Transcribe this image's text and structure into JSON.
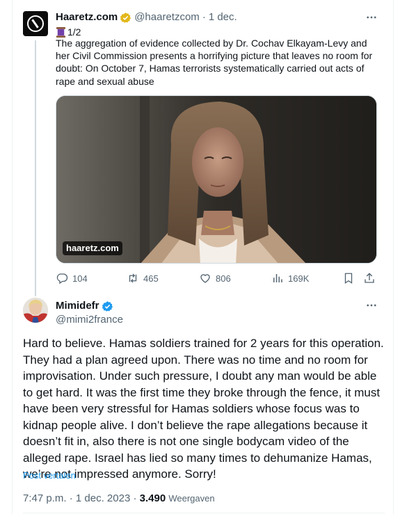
{
  "parent_tweet": {
    "author_name": "Haaretz.com",
    "author_handle": "@haaretzcom",
    "separator": "·",
    "date": "1 dec.",
    "thread_emoji": "spool-of-thread",
    "thread_index": "1/2",
    "text": "The aggregation of evidence collected by Dr. Cochav Elkayam-Levy and her Civil Commission presents a horrifying picture that leaves no room for doubt: On October 7, Hamas terrorists systematically carried out acts of rape and sexual abuse",
    "media_source_label": "haaretz.com",
    "stats": {
      "replies": "104",
      "reposts": "465",
      "likes": "806",
      "views": "169K"
    },
    "icons": [
      "reply-icon",
      "repost-icon",
      "like-icon",
      "views-icon",
      "bookmark-icon",
      "share-icon"
    ]
  },
  "reply_tweet": {
    "author_name": "Mimidefr",
    "author_handle": "@mimi2france",
    "text": "Hard to believe. Hamas soldiers trained for 2 years for this operation. They had a plan agreed upon. There was no time and no room for improvisation. Under such pressure, I doubt any man would be able to get hard. It was the first time they broke through the fence, it must have been very stressful for Hamas soldiers whose focus was to kidnap people alive. I don’t believe the rape allegations because it doesn’t fit in, also there is not one single bodycam video of the alleged rape. Israel has lied so many times to dehumanize Hamas, we’re not impressed anymore. Sorry!",
    "translate_label": "Post vertalen",
    "time": "7:47 p.m.",
    "separator": "·",
    "date": "1 dec. 2023",
    "views_count": "3.490",
    "views_label": "Weergaven"
  },
  "colors": {
    "text_primary": "#0f1419",
    "text_secondary": "#536471",
    "link_blue": "#1d9bf0",
    "verified_gold": "#e2b719",
    "thread_line": "#cfd9de"
  }
}
